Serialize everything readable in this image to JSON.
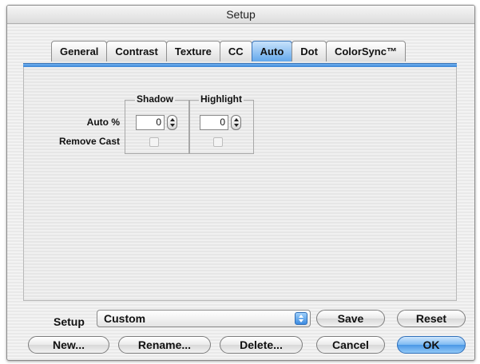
{
  "window": {
    "title": "Setup"
  },
  "tabs": [
    {
      "label": "General"
    },
    {
      "label": "Contrast"
    },
    {
      "label": "Texture"
    },
    {
      "label": "CC"
    },
    {
      "label": "Auto",
      "active": true
    },
    {
      "label": "Dot"
    },
    {
      "label": "ColorSync™"
    }
  ],
  "auto_panel": {
    "shadow_group": {
      "title": "Shadow",
      "auto_value": "0",
      "remove_cast_checked": false
    },
    "highlight_group": {
      "title": "Highlight",
      "auto_value": "0",
      "remove_cast_checked": false
    },
    "row_labels": {
      "auto_percent": "Auto %",
      "remove_cast": "Remove Cast"
    }
  },
  "footer": {
    "setup_label": "Setup",
    "setup_value": "Custom",
    "buttons": {
      "save": "Save",
      "reset": "Reset",
      "new": "New...",
      "rename": "Rename...",
      "delete": "Delete...",
      "cancel": "Cancel",
      "ok": "OK"
    }
  },
  "colors": {
    "accent": "#4a97e6",
    "accent_dark": "#2f6eb8"
  }
}
